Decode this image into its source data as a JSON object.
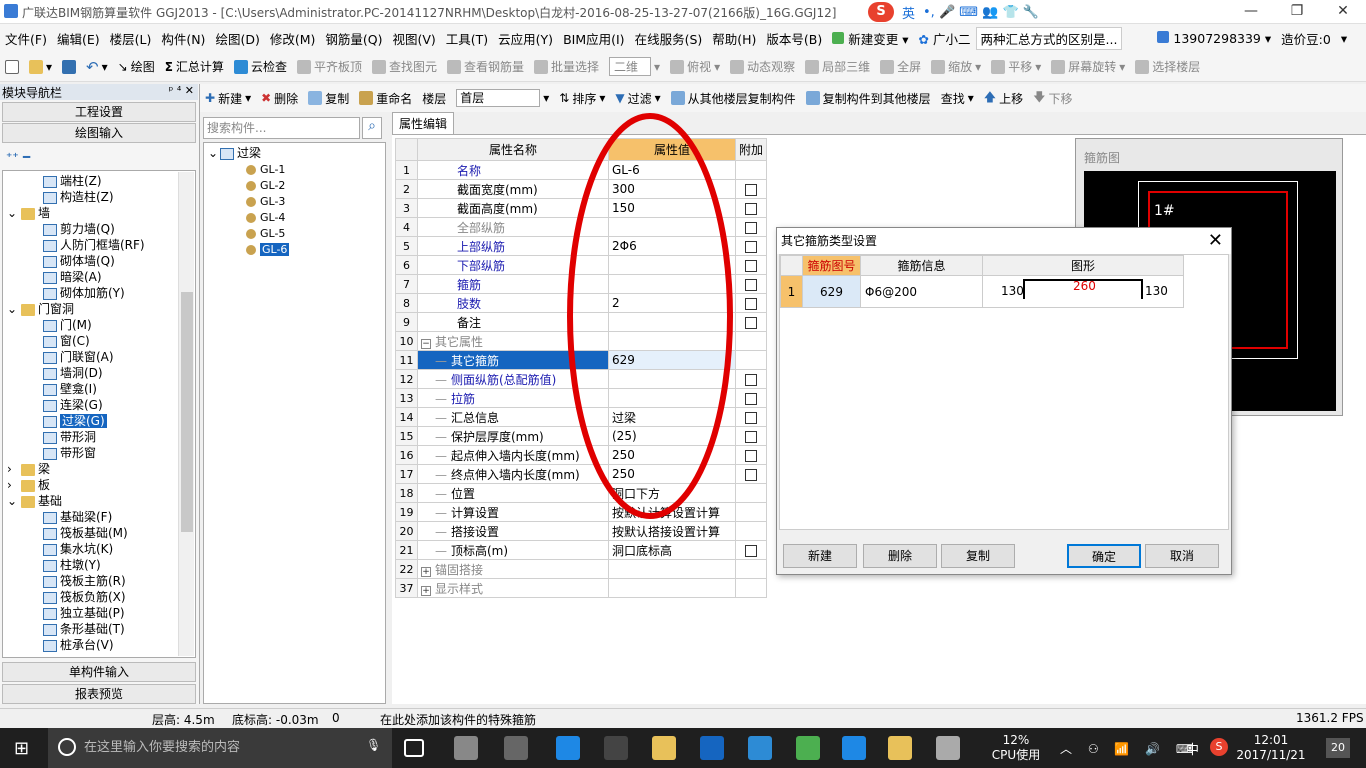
{
  "window": {
    "title": "广联达BIM钢筋算量软件 GGJ2013 - [C:\\Users\\Administrator.PC-20141127NRHM\\Desktop\\白龙村-2016-08-25-13-27-07(2166版)_16G.GGJ12]",
    "minimize": "—",
    "restore": "❐",
    "close": "✕"
  },
  "ime": {
    "logo": "S",
    "mode": "英",
    "icons": "•, 🎤 ⌨ 👥 👕 🔧"
  },
  "menubar": {
    "items": [
      "文件(F)",
      "编辑(E)",
      "楼层(L)",
      "构件(N)",
      "绘图(D)",
      "修改(M)",
      "钢筋量(Q)",
      "视图(V)",
      "工具(T)",
      "云应用(Y)",
      "BIM应用(I)",
      "在线服务(S)",
      "帮助(H)",
      "版本号(B)"
    ],
    "new_change": "新建变更",
    "guangxiaoer": "广小二",
    "notice": "两种汇总方式的区别是...",
    "phone": "13907298339",
    "price": "造价豆:0"
  },
  "toolbar1": {
    "draw": "绘图",
    "sum": "汇总计算",
    "cloudcheck": "云检查",
    "flat": "平齐板顶",
    "find": "查找图元",
    "viewrebar": "查看钢筋量",
    "batch": "批量选择",
    "view2d": "二维",
    "topview": "俯视",
    "dynamic": "动态观察",
    "local3d": "局部三维",
    "fullscreen": "全屏",
    "zoom": "缩放",
    "pan": "平移",
    "rotate": "屏幕旋转",
    "selfloor": "选择楼层"
  },
  "nav": {
    "header": "模块导航栏",
    "pin": "ᵖ ⁴ ✕",
    "btn_project": "工程设置",
    "btn_draw": "绘图输入",
    "btn_single": "单构件输入",
    "btn_report": "报表预览",
    "tree": [
      {
        "label": "端柱(Z)",
        "level": 2,
        "type": "comp"
      },
      {
        "label": "构造柱(Z)",
        "level": 2,
        "type": "comp"
      },
      {
        "label": "墙",
        "level": 1,
        "type": "fold",
        "exp": "⌄"
      },
      {
        "label": "剪力墙(Q)",
        "level": 2,
        "type": "comp"
      },
      {
        "label": "人防门框墙(RF)",
        "level": 2,
        "type": "comp"
      },
      {
        "label": "砌体墙(Q)",
        "level": 2,
        "type": "comp"
      },
      {
        "label": "暗梁(A)",
        "level": 2,
        "type": "comp"
      },
      {
        "label": "砌体加筋(Y)",
        "level": 2,
        "type": "comp"
      },
      {
        "label": "门窗洞",
        "level": 1,
        "type": "fold",
        "exp": "⌄"
      },
      {
        "label": "门(M)",
        "level": 2,
        "type": "comp"
      },
      {
        "label": "窗(C)",
        "level": 2,
        "type": "comp"
      },
      {
        "label": "门联窗(A)",
        "level": 2,
        "type": "comp"
      },
      {
        "label": "墙洞(D)",
        "level": 2,
        "type": "comp"
      },
      {
        "label": "壁龛(I)",
        "level": 2,
        "type": "comp"
      },
      {
        "label": "连梁(G)",
        "level": 2,
        "type": "comp"
      },
      {
        "label": "过梁(G)",
        "level": 2,
        "type": "comp",
        "sel": true
      },
      {
        "label": "带形洞",
        "level": 2,
        "type": "comp"
      },
      {
        "label": "带形窗",
        "level": 2,
        "type": "comp"
      },
      {
        "label": "梁",
        "level": 1,
        "type": "fold",
        "exp": "›"
      },
      {
        "label": "板",
        "level": 1,
        "type": "fold",
        "exp": "›"
      },
      {
        "label": "基础",
        "level": 1,
        "type": "fold",
        "exp": "⌄"
      },
      {
        "label": "基础梁(F)",
        "level": 2,
        "type": "comp"
      },
      {
        "label": "筏板基础(M)",
        "level": 2,
        "type": "comp"
      },
      {
        "label": "集水坑(K)",
        "level": 2,
        "type": "comp"
      },
      {
        "label": "柱墩(Y)",
        "level": 2,
        "type": "comp"
      },
      {
        "label": "筏板主筋(R)",
        "level": 2,
        "type": "comp"
      },
      {
        "label": "筏板负筋(X)",
        "level": 2,
        "type": "comp"
      },
      {
        "label": "独立基础(P)",
        "level": 2,
        "type": "comp"
      },
      {
        "label": "条形基础(T)",
        "level": 2,
        "type": "comp"
      },
      {
        "label": "桩承台(V)",
        "level": 2,
        "type": "comp"
      }
    ]
  },
  "toolbar2": {
    "new": "新建",
    "delete": "删除",
    "copy": "复制",
    "rename": "重命名",
    "floor_label": "楼层",
    "floor_value": "首层",
    "sort": "排序",
    "filter": "过滤",
    "copy_from": "从其他楼层复制构件",
    "copy_to": "复制构件到其他楼层",
    "find": "查找",
    "up": "上移",
    "down": "下移"
  },
  "search": {
    "placeholder": "搜索构件..."
  },
  "comptree": {
    "root": "过梁",
    "items": [
      "GL-1",
      "GL-2",
      "GL-3",
      "GL-4",
      "GL-5",
      "GL-6"
    ],
    "selected_index": 5
  },
  "props": {
    "tab": "属性编辑",
    "headers": [
      "属性名称",
      "属性值",
      "附加"
    ],
    "rows": [
      {
        "n": "1",
        "name": "名称",
        "val": "GL-6",
        "cls": "blue",
        "cb": false
      },
      {
        "n": "2",
        "name": "截面宽度(mm)",
        "val": "300",
        "cls": "",
        "cb": true
      },
      {
        "n": "3",
        "name": "截面高度(mm)",
        "val": "150",
        "cls": "",
        "cb": true
      },
      {
        "n": "4",
        "name": "全部纵筋",
        "val": "",
        "cls": "gray",
        "cb": true
      },
      {
        "n": "5",
        "name": "上部纵筋",
        "val": "2Φ6",
        "cls": "blue",
        "cb": true
      },
      {
        "n": "6",
        "name": "下部纵筋",
        "val": "",
        "cls": "blue",
        "cb": true
      },
      {
        "n": "7",
        "name": "箍筋",
        "val": "",
        "cls": "blue",
        "cb": true
      },
      {
        "n": "8",
        "name": "肢数",
        "val": "2",
        "cls": "blue",
        "cb": true
      },
      {
        "n": "9",
        "name": "备注",
        "val": "",
        "cls": "",
        "cb": true
      },
      {
        "n": "10",
        "name": "其它属性",
        "val": "",
        "cls": "gray",
        "cb": false,
        "group": "−"
      },
      {
        "n": "11",
        "name": "其它箍筋",
        "val": "629",
        "cls": "",
        "cb": false,
        "sub": true,
        "sel": true
      },
      {
        "n": "12",
        "name": "侧面纵筋(总配筋值)",
        "val": "",
        "cls": "blue",
        "cb": true,
        "sub": true
      },
      {
        "n": "13",
        "name": "拉筋",
        "val": "",
        "cls": "blue",
        "cb": true,
        "sub": true
      },
      {
        "n": "14",
        "name": "汇总信息",
        "val": "过梁",
        "cls": "",
        "cb": true,
        "sub": true
      },
      {
        "n": "15",
        "name": "保护层厚度(mm)",
        "val": "(25)",
        "cls": "",
        "cb": true,
        "sub": true
      },
      {
        "n": "16",
        "name": "起点伸入墙内长度(mm)",
        "val": "250",
        "cls": "",
        "cb": true,
        "sub": true
      },
      {
        "n": "17",
        "name": "终点伸入墙内长度(mm)",
        "val": "250",
        "cls": "",
        "cb": true,
        "sub": true
      },
      {
        "n": "18",
        "name": "位置",
        "val": "洞口下方",
        "cls": "",
        "cb": false,
        "sub": true
      },
      {
        "n": "19",
        "name": "计算设置",
        "val": "按默认计算设置计算",
        "cls": "",
        "cb": false,
        "sub": true
      },
      {
        "n": "20",
        "name": "搭接设置",
        "val": "按默认搭接设置计算",
        "cls": "",
        "cb": false,
        "sub": true
      },
      {
        "n": "21",
        "name": "顶标高(m)",
        "val": "洞口底标高",
        "cls": "",
        "cb": true,
        "sub": true
      },
      {
        "n": "22",
        "name": "锚固搭接",
        "val": "",
        "cls": "gray",
        "cb": false,
        "group": "+"
      },
      {
        "n": "37",
        "name": "显示样式",
        "val": "",
        "cls": "gray",
        "cb": false,
        "group": "+"
      }
    ]
  },
  "stirrup_panel": {
    "label": "箍筋图",
    "marker": "1#"
  },
  "dialog": {
    "title": "其它箍筋类型设置",
    "close": "✕",
    "headers": [
      "箍筋图号",
      "箍筋信息",
      "图形"
    ],
    "row": {
      "idx": "1",
      "code": "629",
      "info": "Φ6@200",
      "left": "130",
      "mid": "260",
      "right": "130"
    },
    "btn_new": "新建",
    "btn_delete": "删除",
    "btn_copy": "复制",
    "btn_ok": "确定",
    "btn_cancel": "取消"
  },
  "status": {
    "floor_height": "层高: 4.5m",
    "base_elev": "底标高: -0.03m",
    "zero": "0",
    "hint": "在此处添加该构件的特殊箍筋",
    "fps": "1361.2 FPS"
  },
  "taskbar": {
    "search_placeholder": "在这里输入你要搜索的内容",
    "cpu_percent": "12%",
    "cpu_label": "CPU使用",
    "lang": "中",
    "time": "12:01",
    "date": "2017/11/21",
    "notif": "20"
  },
  "colors": {
    "accent": "#1565c0",
    "annotation_red": "#e00000",
    "selected_header": "#f6c16b"
  }
}
